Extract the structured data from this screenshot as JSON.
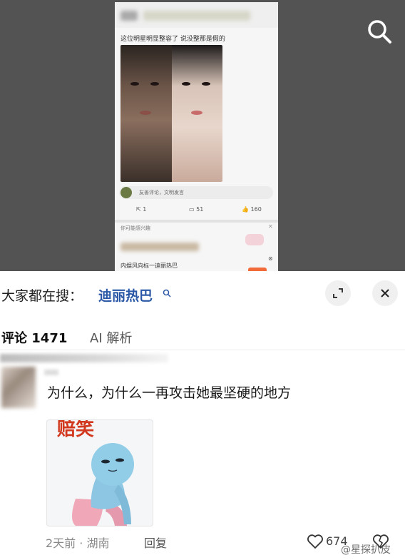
{
  "top_post": {
    "caption": "这位明星明显整容了 说没整那是假的",
    "comment_placeholder": "友善评论，文明发言",
    "stats": {
      "reposts": "1",
      "comments": "51",
      "likes": "160"
    },
    "interest_title": "你可能感兴趣",
    "interest_item": "内娱风向标一迪丽热巴"
  },
  "search_bar": {
    "prefix": "大家都在搜：",
    "term": "迪丽热巴"
  },
  "tabs": [
    {
      "label": "评论 1471",
      "active": true
    },
    {
      "label": "AI 解析",
      "active": false
    }
  ],
  "comment": {
    "text": "为什么，为什么一再攻击她最坚硬的地方",
    "meme_caption": "赔笑",
    "time_location": "2天前 · 湖南",
    "reply_label": "回复",
    "like_count": "674"
  },
  "watermark": "@星探扒皮",
  "icons": {
    "search": "search-icon",
    "expand": "expand-icon",
    "close": "close-icon",
    "like": "heart-icon",
    "dislike": "broken-heart-icon"
  },
  "colors": {
    "accent_blue": "#2a57a6",
    "meme_red": "#d2381e"
  }
}
